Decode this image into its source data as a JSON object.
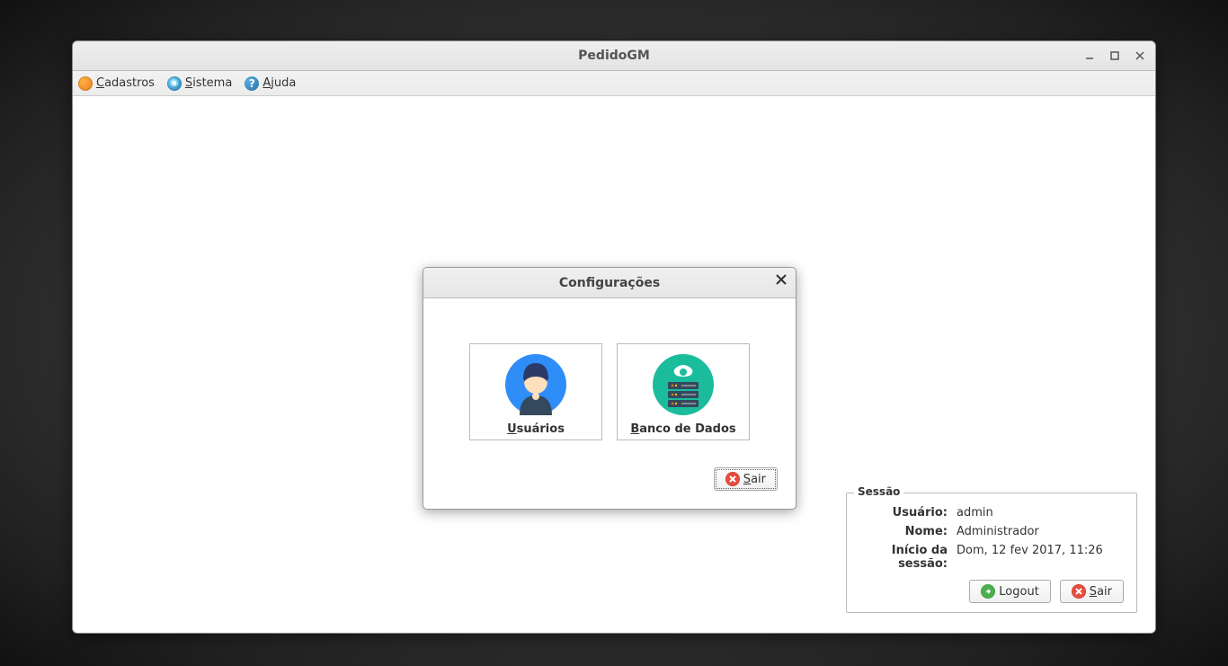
{
  "window": {
    "title": "PedidoGM"
  },
  "menubar": {
    "cadastros": "Cadastros",
    "sistema": "Sistema",
    "ajuda": "Ajuda"
  },
  "session": {
    "legend": "Sessão",
    "labels": {
      "usuario": "Usuário:",
      "nome": "Nome:",
      "inicio": "Início da sessão:"
    },
    "values": {
      "usuario": "admin",
      "nome": "Administrador",
      "inicio": "Dom, 12 fev 2017, 11:26"
    },
    "logout_label": "Logout",
    "sair_label": "Sair"
  },
  "dialog": {
    "title": "Configurações",
    "tiles": {
      "usuarios": "Usuários",
      "banco": "Banco de Dados"
    },
    "sair_label": "Sair"
  }
}
